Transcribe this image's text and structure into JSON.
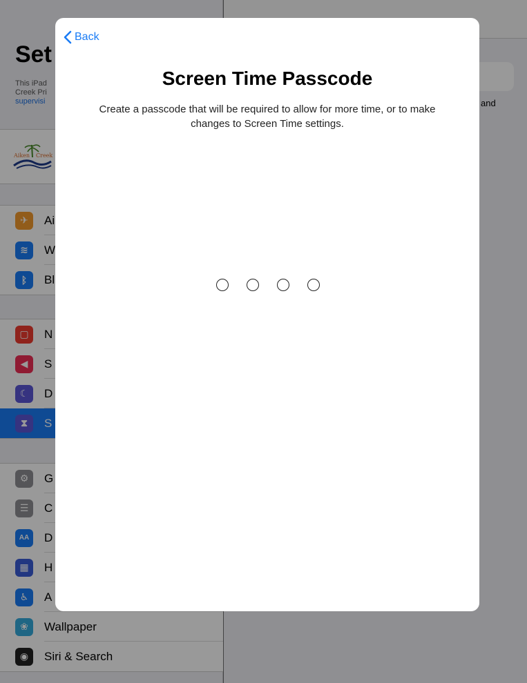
{
  "sidebar": {
    "title": "Set",
    "supervision_text": [
      "This iPad",
      "Creek Pri"
    ],
    "supervision_link": "supervisi",
    "groups": [
      {
        "items": [
          {
            "label": "Ai",
            "icon": "airplane-icon",
            "color": "#f29a2e"
          },
          {
            "label": "W",
            "icon": "wifi-icon",
            "color": "#1a7cf5"
          },
          {
            "label": "Bl",
            "icon": "bluetooth-icon",
            "color": "#1a7cf5"
          }
        ]
      },
      {
        "items": [
          {
            "label": "N",
            "icon": "notifications-icon",
            "color": "#ee3b30"
          },
          {
            "label": "S",
            "icon": "sounds-icon",
            "color": "#ee2d55"
          },
          {
            "label": "D",
            "icon": "moon-icon",
            "color": "#5b55d6"
          },
          {
            "label": "S",
            "icon": "hourglass-icon",
            "color": "#5b55d6",
            "selected": true
          }
        ]
      },
      {
        "items": [
          {
            "label": "G",
            "icon": "gear-icon",
            "color": "#8e8e93"
          },
          {
            "label": "C",
            "icon": "control-center-icon",
            "color": "#8e8e93"
          },
          {
            "label": "D",
            "icon": "display-icon",
            "color": "#1a7cf5"
          },
          {
            "label": "H",
            "icon": "home-screen-icon",
            "color": "#3a5cd8"
          },
          {
            "label": "A",
            "icon": "accessibility-icon",
            "color": "#1a7cf5"
          },
          {
            "label": "Wallpaper",
            "icon": "wallpaper-icon",
            "color": "#35aadc"
          },
          {
            "label": "Siri & Search",
            "icon": "siri-icon",
            "color": "#222"
          }
        ]
      }
    ]
  },
  "detail": {
    "partial_text": "and"
  },
  "sheet": {
    "back_label": "Back",
    "title": "Screen Time Passcode",
    "description": "Create a passcode that will be required to allow for more time, or to make changes to Screen Time settings.",
    "passcode_length": 4
  },
  "colors": {
    "accent": "#1a7cf5",
    "sidebar_bg": "#eeeef3"
  }
}
